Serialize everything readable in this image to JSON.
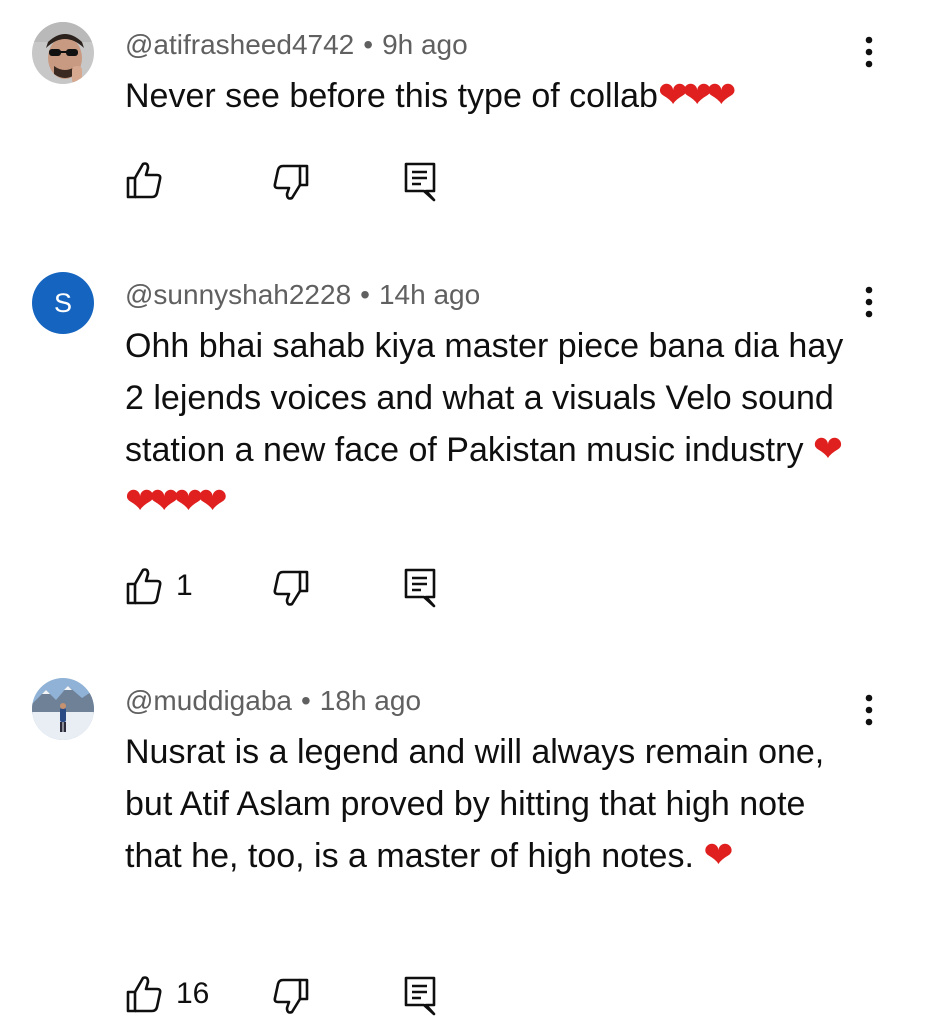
{
  "comments": [
    {
      "handle": "@atifrasheed4742",
      "time": "9h ago",
      "text": "Never see before this type of collab",
      "emoji": "❤❤❤",
      "likes": ""
    },
    {
      "handle": "@sunnyshah2228",
      "time": "14h ago",
      "avatar_letter": "S",
      "text": "Ohh bhai sahab kiya master piece bana dia hay 2 lejends voices and what a visuals Velo sound station a new face of Pakistan music industry ",
      "emoji": "❤❤❤❤❤",
      "likes": "1"
    },
    {
      "handle": "@muddigaba",
      "time": "18h ago",
      "text": "Nusrat is a legend and will always remain one, but Atif Aslam proved by hitting that high note that he, too, is a master of high notes. ",
      "emoji": "❤",
      "likes": "16"
    }
  ],
  "separator": "•",
  "icons": {
    "like": "thumb-up-icon",
    "dislike": "thumb-down-icon",
    "reply": "reply-icon",
    "more": "more-vert-icon"
  },
  "colors": {
    "heart": "#e0201f",
    "avatar_letter_bg": "#1565c0",
    "meta_text": "#606060"
  }
}
